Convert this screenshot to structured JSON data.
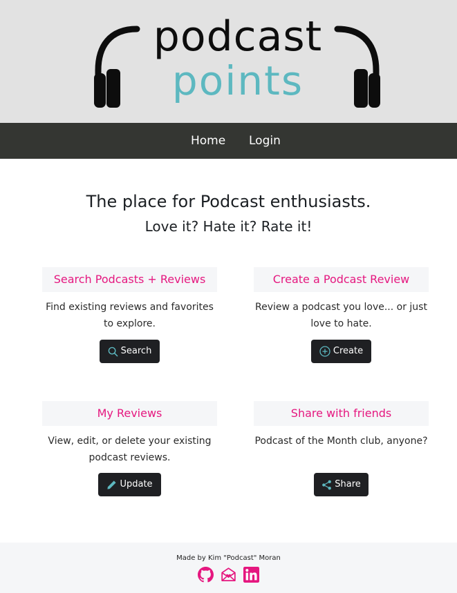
{
  "logo": {
    "top_text": "podcast",
    "bottom_text": "points"
  },
  "nav": {
    "items": [
      {
        "label": "Home"
      },
      {
        "label": "Login"
      }
    ]
  },
  "hero": {
    "tagline": "The place for Podcast enthusiasts.",
    "subtagline": "Love it? Hate it? Rate it!"
  },
  "cards": [
    {
      "title": "Search Podcasts + Reviews",
      "text": "Find existing reviews and favorites to explore.",
      "button_label": "Search",
      "icon": "search-icon"
    },
    {
      "title": "Create a Podcast Review",
      "text": "Review a podcast you love... or just love to hate.",
      "button_label": "Create",
      "icon": "plus-circle-icon"
    },
    {
      "title": "My Reviews",
      "text": "View, edit, or delete your existing podcast reviews.",
      "button_label": "Update",
      "icon": "pencil-icon"
    },
    {
      "title": "Share with friends",
      "text": "Podcast of the Month club, anyone?",
      "button_label": "Share",
      "icon": "share-icon"
    }
  ],
  "footer": {
    "credit": "Made by Kim \"Podcast\" Moran",
    "icons": [
      "github-icon",
      "envelope-heart-icon",
      "linkedin-icon"
    ]
  },
  "colors": {
    "accent_pink": "#e5177f",
    "logo_teal": "#5db8c0",
    "nav_bg": "#343632",
    "header_bg": "#e2e2e2",
    "button_bg": "#1f2023"
  }
}
